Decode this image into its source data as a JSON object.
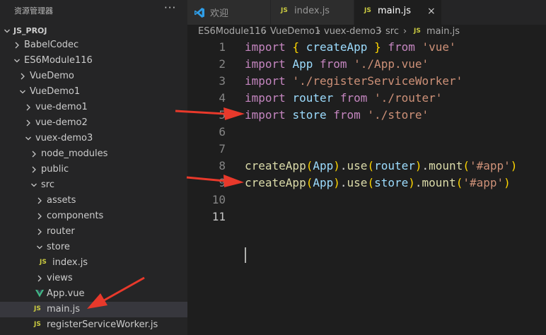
{
  "sidebar": {
    "title": "资源管理器",
    "more": "···",
    "items": [
      {
        "label": "JS_PROJ",
        "kind": "folder-open",
        "root": true
      },
      {
        "label": "BabelCodec",
        "kind": "folder-closed"
      },
      {
        "label": "ES6Module116",
        "kind": "folder-open"
      },
      {
        "label": "VueDemo",
        "kind": "folder-closed"
      },
      {
        "label": "VueDemo1",
        "kind": "folder-open"
      },
      {
        "label": "vue-demo1",
        "kind": "folder-closed"
      },
      {
        "label": "vue-demo2",
        "kind": "folder-closed"
      },
      {
        "label": "vuex-demo3",
        "kind": "folder-open"
      },
      {
        "label": "node_modules",
        "kind": "folder-closed"
      },
      {
        "label": "public",
        "kind": "folder-closed"
      },
      {
        "label": "src",
        "kind": "folder-open"
      },
      {
        "label": "assets",
        "kind": "folder-closed"
      },
      {
        "label": "components",
        "kind": "folder-closed"
      },
      {
        "label": "router",
        "kind": "folder-closed"
      },
      {
        "label": "store",
        "kind": "folder-open"
      },
      {
        "label": "index.js",
        "kind": "js-file",
        "badge": "JS"
      },
      {
        "label": "views",
        "kind": "folder-closed"
      },
      {
        "label": "App.vue",
        "kind": "vue-file"
      },
      {
        "label": "main.js",
        "kind": "js-file",
        "badge": "JS",
        "selected": true
      },
      {
        "label": "registerServiceWorker.js",
        "kind": "js-file",
        "badge": "JS"
      }
    ]
  },
  "tabs": [
    {
      "label": "欢迎",
      "icon": "vscode-icon"
    },
    {
      "label": "index.js",
      "icon": "js-file-icon",
      "badge": "JS"
    },
    {
      "label": "main.js",
      "icon": "js-file-icon",
      "badge": "JS",
      "active": true,
      "close": "×"
    }
  ],
  "breadcrumb": {
    "parts": [
      "ES6Module116",
      "VueDemo1",
      "vuex-demo3",
      "src"
    ],
    "sep": "›",
    "file_badge": "JS",
    "file": "main.js"
  },
  "editor": {
    "line_numbers": [
      "1",
      "2",
      "3",
      "4",
      "5",
      "6",
      "7",
      "8",
      "9",
      "10",
      "11"
    ],
    "current_line": "11",
    "lines": [
      [
        [
          "kw",
          "import"
        ],
        [
          "p",
          " "
        ],
        [
          "br1",
          "{"
        ],
        [
          "p",
          " "
        ],
        [
          "id",
          "createApp"
        ],
        [
          "p",
          " "
        ],
        [
          "br1",
          "}"
        ],
        [
          "p",
          " "
        ],
        [
          "kw",
          "from"
        ],
        [
          "p",
          " "
        ],
        [
          "str",
          "'vue'"
        ]
      ],
      [
        [
          "kw",
          "import"
        ],
        [
          "p",
          " "
        ],
        [
          "id",
          "App"
        ],
        [
          "p",
          " "
        ],
        [
          "kw",
          "from"
        ],
        [
          "p",
          " "
        ],
        [
          "str",
          "'./App.vue'"
        ]
      ],
      [
        [
          "kw",
          "import"
        ],
        [
          "p",
          " "
        ],
        [
          "str",
          "'./registerServiceWorker'"
        ]
      ],
      [
        [
          "kw",
          "import"
        ],
        [
          "p",
          " "
        ],
        [
          "id",
          "router"
        ],
        [
          "p",
          " "
        ],
        [
          "kw",
          "from"
        ],
        [
          "p",
          " "
        ],
        [
          "str",
          "'./router'"
        ]
      ],
      [
        [
          "kw",
          "import"
        ],
        [
          "p",
          " "
        ],
        [
          "id",
          "store"
        ],
        [
          "p",
          " "
        ],
        [
          "kw",
          "from"
        ],
        [
          "p",
          " "
        ],
        [
          "str",
          "'./store'"
        ]
      ],
      [],
      [],
      [
        [
          "fn",
          "createApp"
        ],
        [
          "br1",
          "("
        ],
        [
          "id",
          "App"
        ],
        [
          "br1",
          ")"
        ],
        [
          "p",
          "."
        ],
        [
          "fn",
          "use"
        ],
        [
          "br1",
          "("
        ],
        [
          "id",
          "router"
        ],
        [
          "br1",
          ")"
        ],
        [
          "p",
          "."
        ],
        [
          "fn",
          "mount"
        ],
        [
          "br1",
          "("
        ],
        [
          "str",
          "'#app'"
        ],
        [
          "br1",
          ")"
        ]
      ],
      [
        [
          "fn",
          "createApp"
        ],
        [
          "br1",
          "("
        ],
        [
          "id",
          "App"
        ],
        [
          "br1",
          ")"
        ],
        [
          "p",
          "."
        ],
        [
          "fn",
          "use"
        ],
        [
          "br1",
          "("
        ],
        [
          "id",
          "store"
        ],
        [
          "br1",
          ")"
        ],
        [
          "p",
          "."
        ],
        [
          "fn",
          "mount"
        ],
        [
          "br1",
          "("
        ],
        [
          "str",
          "'#app'"
        ],
        [
          "br1",
          ")"
        ]
      ],
      [],
      []
    ]
  },
  "colors": {
    "background": "#1e1e1e",
    "sidebar": "#252526",
    "selection": "#37373d",
    "arrow": "#e8392b",
    "js_badge": "#cbcb41",
    "vue_icon": "#41b883"
  }
}
